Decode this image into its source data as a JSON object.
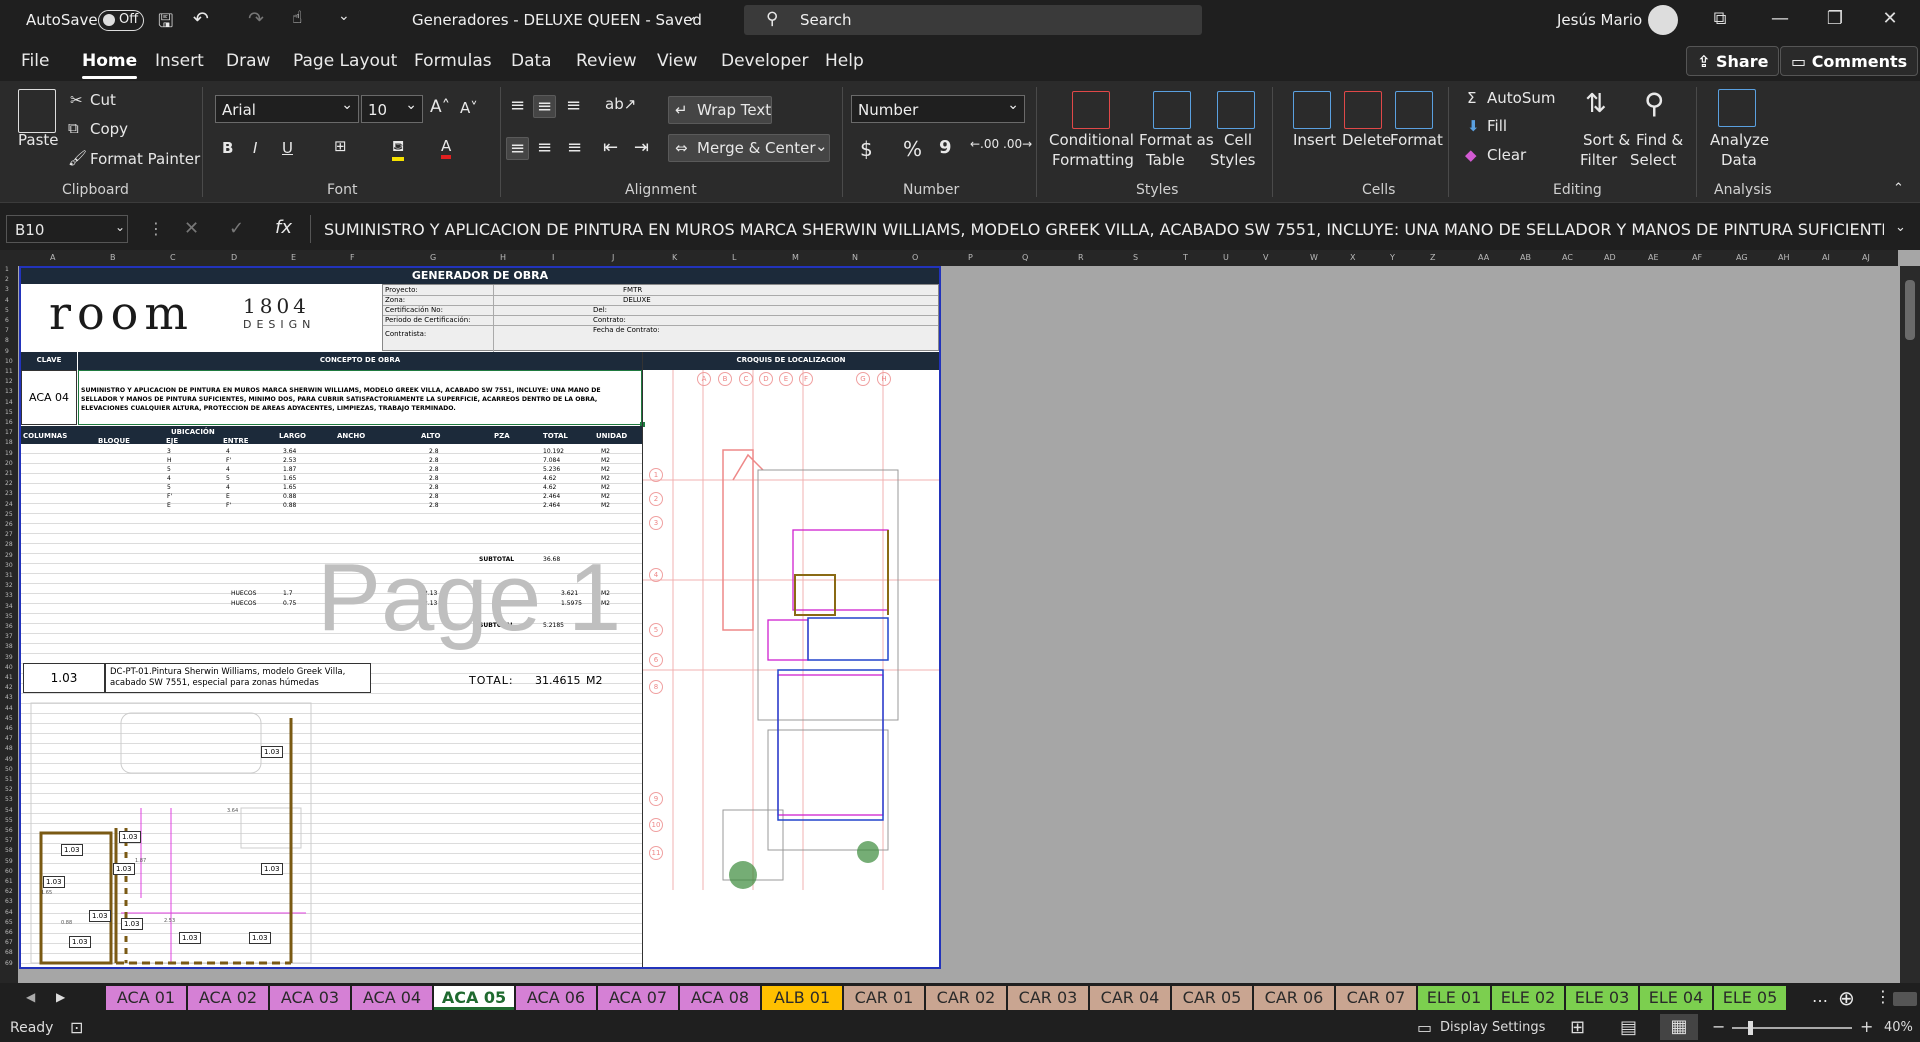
{
  "titlebar": {
    "autosave_label": "AutoSave",
    "autosave_state": "Off",
    "doc_title": "Generadores - DELUXE QUEEN  -  Saved",
    "search_placeholder": "Search",
    "user_name": "Jesús Mario"
  },
  "menu": {
    "items": [
      "File",
      "Home",
      "Insert",
      "Draw",
      "Page Layout",
      "Formulas",
      "Data",
      "Review",
      "View",
      "Developer",
      "Help"
    ],
    "active": "Home",
    "share_label": "Share",
    "comments_label": "Comments"
  },
  "ribbon": {
    "clipboard": {
      "paste": "Paste",
      "cut": "Cut",
      "copy": "Copy",
      "format_painter": "Format Painter",
      "group": "Clipboard"
    },
    "font": {
      "family": "Arial",
      "size": "10",
      "group": "Font",
      "bold": "B",
      "italic": "I",
      "underline": "U"
    },
    "alignment": {
      "wrap_text": "Wrap Text",
      "merge_center": "Merge & Center",
      "group": "Alignment"
    },
    "number": {
      "format": "Number",
      "currency": "$",
      "percent": "%",
      "comma": "9",
      "group": "Number"
    },
    "styles": {
      "conditional": [
        "Conditional",
        "Formatting"
      ],
      "format_table": [
        "Format as",
        "Table"
      ],
      "cell_styles": [
        "Cell",
        "Styles"
      ],
      "group": "Styles"
    },
    "cells": {
      "insert": "Insert",
      "delete": "Delete",
      "format": "Format",
      "group": "Cells"
    },
    "editing": {
      "autosum": "AutoSum",
      "fill": "Fill",
      "clear": "Clear",
      "sort_filter": [
        "Sort &",
        "Filter"
      ],
      "find_select": [
        "Find &",
        "Select"
      ],
      "group": "Editing"
    },
    "analysis": {
      "analyze": [
        "Analyze",
        "Data"
      ],
      "group": "Analysis"
    }
  },
  "formula_bar": {
    "name_box": "B10",
    "fx": "fx",
    "content": "SUMINISTRO Y APLICACION DE PINTURA EN MUROS MARCA SHERWIN WILLIAMS, MODELO GREEK VILLA, ACABADO SW 7551, INCLUYE: UNA MANO DE SELLADOR Y MANOS DE PINTURA SUFICIENTES, MINIMO"
  },
  "columns": [
    "A",
    "B",
    "C",
    "D",
    "E",
    "F",
    "G",
    "H",
    "I",
    "J",
    "K",
    "L",
    "M",
    "N",
    "O",
    "P",
    "Q",
    "R",
    "S",
    "T",
    "U",
    "V",
    "W",
    "X",
    "Y",
    "Z",
    "AA",
    "AB",
    "AC",
    "AD",
    "AE",
    "AF",
    "AG",
    "AH",
    "AI",
    "AJ"
  ],
  "sheet": {
    "title": "GENERADOR DE OBRA",
    "logo_main": "room",
    "logo_num": "1804",
    "logo_sub": "DESIGN",
    "info_labels": [
      "Proyecto:",
      "Zona:",
      "Certificación No:",
      "Periodo de Certificación:",
      "Contratista:"
    ],
    "info_values": [
      "FMTR",
      "DELUXE"
    ],
    "info_right_labels": [
      "Del:",
      "Contrato:",
      "Fecha de Contrato:"
    ],
    "hdr_clave": "CLAVE",
    "hdr_concepto": "CONCEPTO DE OBRA",
    "hdr_croquis": "CROQUIS DE LOCALIZACION",
    "clave": "ACA 04",
    "concepto": "SUMINISTRO Y APLICACION DE PINTURA EN MUROS MARCA SHERWIN WILLIAMS, MODELO GREEK VILLA, ACABADO SW 7551, INCLUYE: UNA MANO DE SELLADOR Y MANOS DE PINTURA SUFICIENTES, MINIMO DOS, PARA CUBRIR SATISFACTORIAMENTE LA SUPERFICIE, ACARREOS DENTRO DE LA OBRA, ELEVACIONES CUALQUIER ALTURA, PROTECCION DE AREAS ADYACENTES, LIMPIEZAS, TRABAJO TERMINADO.",
    "table_headers": [
      "COLUMNAS",
      "UBICACIÓN",
      "BLOQUE",
      "EJE",
      "ENTRE",
      "LARGO",
      "ANCHO",
      "ALTO",
      "PZA",
      "TOTAL",
      "UNIDAD"
    ],
    "rows": [
      [
        "3",
        "4",
        "3.64",
        "2.8",
        "10.192",
        "M2"
      ],
      [
        "H",
        "F'",
        "2.53",
        "2.8",
        "7.084",
        "M2"
      ],
      [
        "5",
        "4",
        "1.87",
        "2.8",
        "5.236",
        "M2"
      ],
      [
        "4",
        "5",
        "1.65",
        "2.8",
        "4.62",
        "M2"
      ],
      [
        "5",
        "4",
        "1.65",
        "2.8",
        "4.62",
        "M2"
      ],
      [
        "F'",
        "E",
        "0.88",
        "2.8",
        "2.464",
        "M2"
      ],
      [
        "E",
        "F'",
        "0.88",
        "2.8",
        "2.464",
        "M2"
      ]
    ],
    "subtotal_label": "SUBTOTAL",
    "subtotal1": "36.68",
    "huecos": [
      [
        "HUECOS",
        "1.7",
        "2.13",
        "3.621",
        "M2"
      ],
      [
        "HUECOS",
        "0.75",
        "2.13",
        "1.5975",
        "M2"
      ]
    ],
    "subtotal2": "5.2185",
    "watermark": "Page 1",
    "spec_code": "1.03",
    "spec_text": "DC-PT-01.Pintura Sherwin Williams, modelo Greek Villa, acabado SW 7551, especial para zonas húmedas",
    "total_label": "TOTAL:",
    "total_value": "31.4615",
    "total_unit": "M2",
    "plan_tags": [
      "1.03"
    ],
    "dims": [
      "3.64",
      "2.53",
      "1.87",
      "1.65",
      "0.88"
    ],
    "grid_letters": [
      "A",
      "B",
      "C",
      "D",
      "E",
      "F",
      "G",
      "H"
    ],
    "grid_numbers": [
      "1",
      "2",
      "3",
      "4",
      "5",
      "6",
      "8",
      "9",
      "10",
      "11"
    ]
  },
  "tabs": [
    {
      "label": "ACA 01",
      "color": "#d580d5"
    },
    {
      "label": "ACA 02",
      "color": "#d580d5"
    },
    {
      "label": "ACA 03",
      "color": "#d580d5"
    },
    {
      "label": "ACA 04",
      "color": "#d580d5"
    },
    {
      "label": "ACA 05",
      "color": "#ffffff",
      "active": true
    },
    {
      "label": "ACA 06",
      "color": "#d580d5"
    },
    {
      "label": "ACA 07",
      "color": "#d580d5"
    },
    {
      "label": "ACA 08",
      "color": "#d580d5"
    },
    {
      "label": "ALB 01",
      "color": "#ffc000"
    },
    {
      "label": "CAR 01",
      "color": "#c9a591"
    },
    {
      "label": "CAR 02",
      "color": "#c9a591"
    },
    {
      "label": "CAR 03",
      "color": "#c9a591"
    },
    {
      "label": "CAR 04",
      "color": "#c9a591"
    },
    {
      "label": "CAR 05",
      "color": "#c9a591"
    },
    {
      "label": "CAR 06",
      "color": "#c9a591"
    },
    {
      "label": "CAR 07",
      "color": "#c9a591"
    },
    {
      "label": "ELE 01",
      "color": "#7ccf4f"
    },
    {
      "label": "ELE 02",
      "color": "#7ccf4f"
    },
    {
      "label": "ELE 03",
      "color": "#7ccf4f"
    },
    {
      "label": "ELE 04",
      "color": "#7ccf4f"
    },
    {
      "label": "ELE 05",
      "color": "#7ccf4f"
    }
  ],
  "status": {
    "ready": "Ready",
    "display_settings": "Display Settings",
    "zoom": "40%"
  }
}
